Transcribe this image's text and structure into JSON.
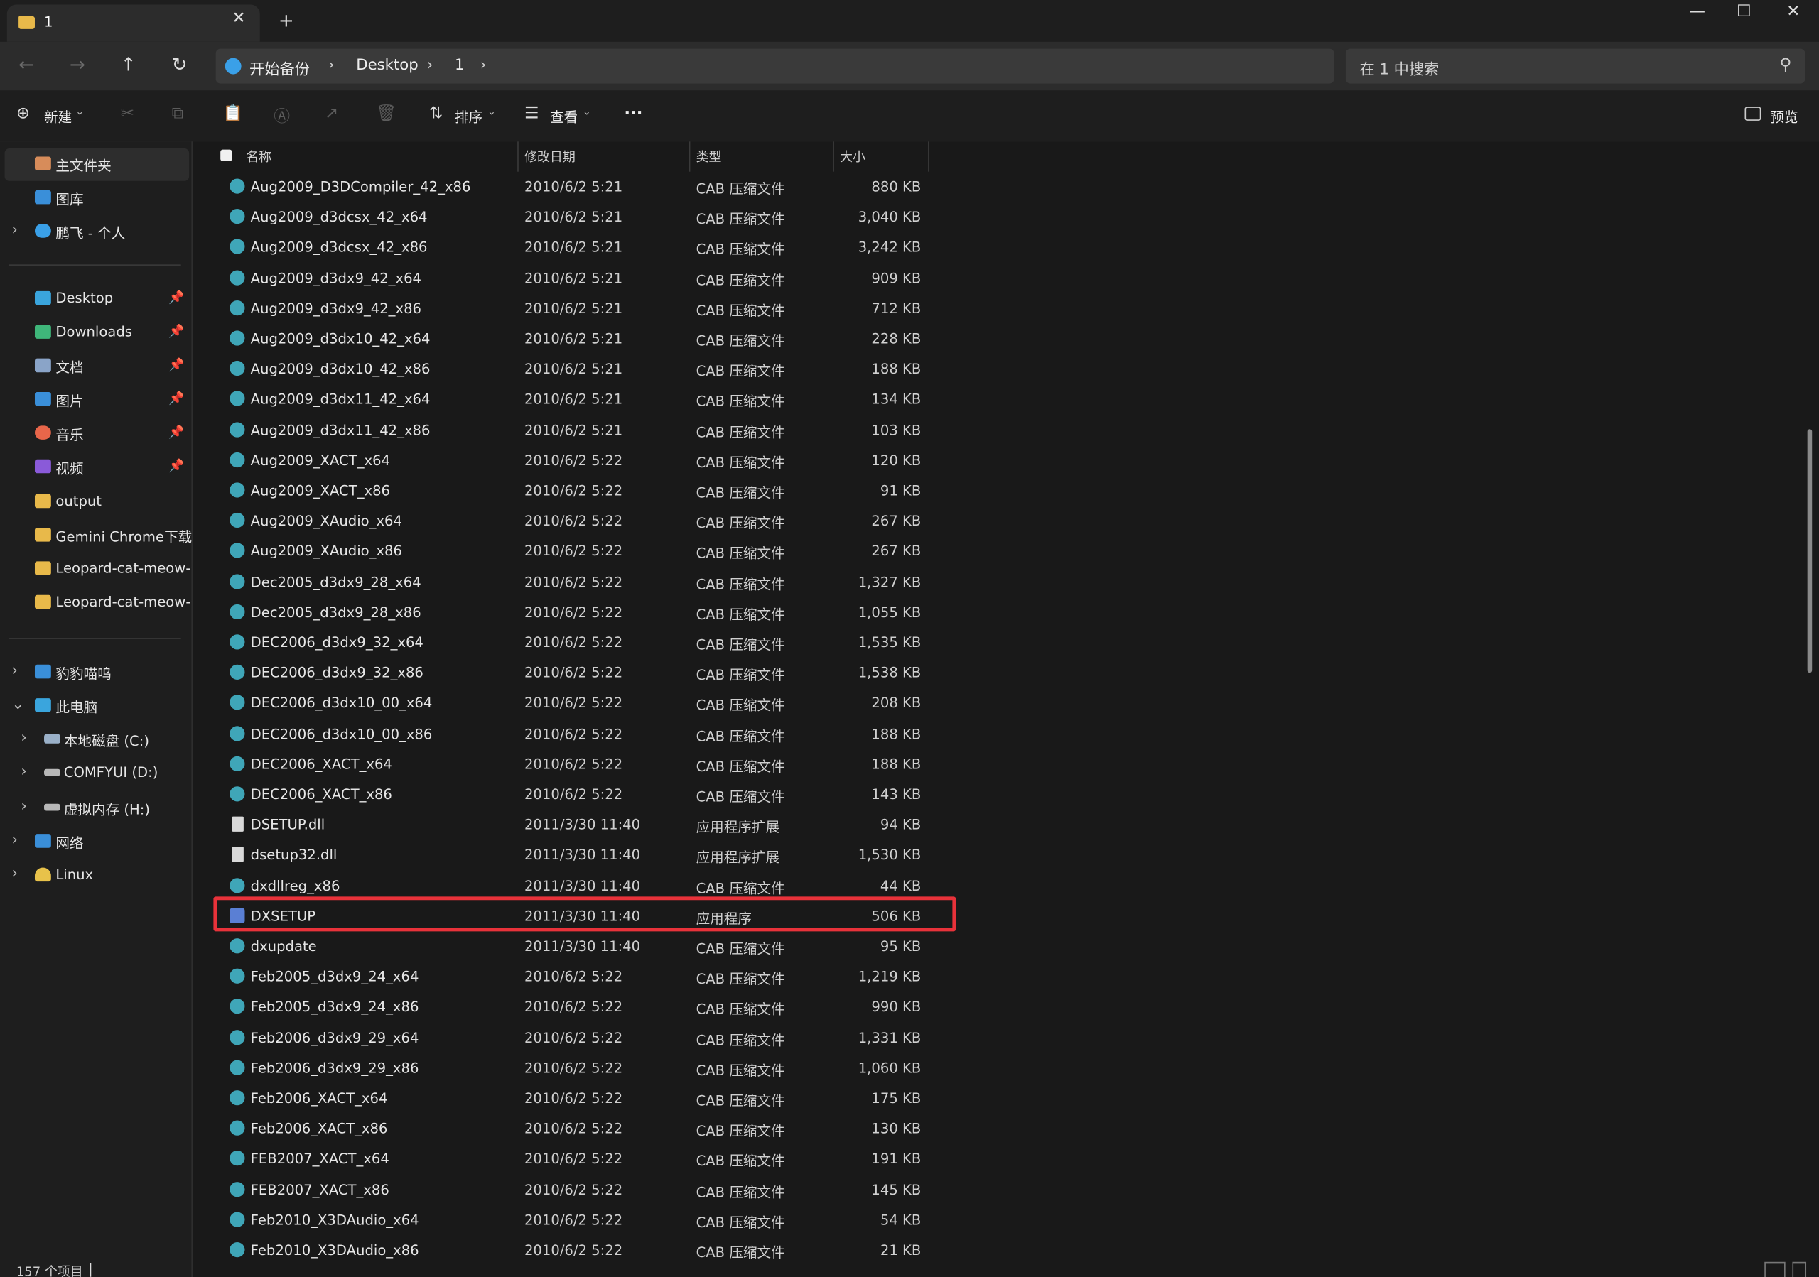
{
  "window": {
    "tab_title": "1",
    "tab_close": "✕",
    "new_tab": "+",
    "controls": [
      "—",
      "☐",
      "✕"
    ]
  },
  "address": {
    "nav": [
      "←",
      "→",
      "↑",
      "↻"
    ],
    "crumbs": [
      "开始备份",
      "Desktop",
      "1"
    ],
    "separator": "›",
    "search_placeholder": "在 1 中搜索",
    "search_icon": "⚲"
  },
  "toolbar": {
    "new": "新建",
    "disabled_icons": [
      "✂",
      "⧉",
      "📋",
      "Ⓐ",
      "↗",
      "🗑"
    ],
    "sort": "排序",
    "view": "查看",
    "more": "···",
    "preview": "预览"
  },
  "sidebar": {
    "top_items": [
      {
        "label": "主文件夹",
        "icon": "home-icon",
        "color": "#d78c5a",
        "selected": true
      },
      {
        "label": "图库",
        "icon": "gallery-icon",
        "color": "#3a8fd9"
      },
      {
        "label": "鹏飞 - 个人",
        "icon": "cloud-icon",
        "color": "#3aa0e8",
        "expand": true
      }
    ],
    "pinned": [
      {
        "label": "Desktop",
        "icon": "desktop-icon",
        "color": "#3aa5dd",
        "pinned": true
      },
      {
        "label": "Downloads",
        "icon": "download-icon",
        "color": "#3fb67a",
        "pinned": true
      },
      {
        "label": "文档",
        "icon": "document-icon",
        "color": "#8aa4c8",
        "pinned": true
      },
      {
        "label": "图片",
        "icon": "pictures-icon",
        "color": "#3a8fd9",
        "pinned": true
      },
      {
        "label": "音乐",
        "icon": "music-icon",
        "color": "#e8664a",
        "pinned": true
      },
      {
        "label": "视频",
        "icon": "video-icon",
        "color": "#8a5ad9",
        "pinned": true
      },
      {
        "label": "output",
        "icon": "folder-icon",
        "color": "#e8b94a"
      },
      {
        "label": "Gemini Chrome下载",
        "icon": "folder-icon",
        "color": "#e8b94a"
      },
      {
        "label": "Leopard-cat-meow-Co",
        "icon": "folder-icon",
        "color": "#e8b94a"
      },
      {
        "label": "Leopard-cat-meow-Co",
        "icon": "folder-icon",
        "color": "#e8b94a"
      }
    ],
    "tree": [
      {
        "label": "豹豹喵呜",
        "icon": "cloud-folder-icon",
        "color": "#3a8fd9",
        "chev": "›",
        "indent": 0
      },
      {
        "label": "此电脑",
        "icon": "pc-icon",
        "color": "#3aa5dd",
        "chev": "⌄",
        "indent": 0
      },
      {
        "label": "本地磁盘 (C:)",
        "icon": "drive-icon",
        "color": "#9ab0c8",
        "chev": "›",
        "indent": 1
      },
      {
        "label": "COMFYUI (D:)",
        "icon": "drive-icon",
        "color": "#b8b8b8",
        "chev": "›",
        "indent": 1
      },
      {
        "label": "虚拟内存 (H:)",
        "icon": "drive-icon",
        "color": "#b8b8b8",
        "chev": "›",
        "indent": 1
      },
      {
        "label": "网络",
        "icon": "network-icon",
        "color": "#3a8fd9",
        "chev": "›",
        "indent": 0
      },
      {
        "label": "Linux",
        "icon": "linux-icon",
        "color": "#e8c24a",
        "chev": "›",
        "indent": 0
      }
    ]
  },
  "columns": {
    "name": "名称",
    "date": "修改日期",
    "type": "类型",
    "size": "大小"
  },
  "files": [
    {
      "name": "Aug2009_D3DCompiler_42_x86",
      "date": "2010/6/2 5:21",
      "type": "CAB 压缩文件",
      "size": "880 KB",
      "icon": "cab"
    },
    {
      "name": "Aug2009_d3dcsx_42_x64",
      "date": "2010/6/2 5:21",
      "type": "CAB 压缩文件",
      "size": "3,040 KB",
      "icon": "cab"
    },
    {
      "name": "Aug2009_d3dcsx_42_x86",
      "date": "2010/6/2 5:21",
      "type": "CAB 压缩文件",
      "size": "3,242 KB",
      "icon": "cab"
    },
    {
      "name": "Aug2009_d3dx9_42_x64",
      "date": "2010/6/2 5:21",
      "type": "CAB 压缩文件",
      "size": "909 KB",
      "icon": "cab"
    },
    {
      "name": "Aug2009_d3dx9_42_x86",
      "date": "2010/6/2 5:21",
      "type": "CAB 压缩文件",
      "size": "712 KB",
      "icon": "cab"
    },
    {
      "name": "Aug2009_d3dx10_42_x64",
      "date": "2010/6/2 5:21",
      "type": "CAB 压缩文件",
      "size": "228 KB",
      "icon": "cab"
    },
    {
      "name": "Aug2009_d3dx10_42_x86",
      "date": "2010/6/2 5:21",
      "type": "CAB 压缩文件",
      "size": "188 KB",
      "icon": "cab"
    },
    {
      "name": "Aug2009_d3dx11_42_x64",
      "date": "2010/6/2 5:21",
      "type": "CAB 压缩文件",
      "size": "134 KB",
      "icon": "cab"
    },
    {
      "name": "Aug2009_d3dx11_42_x86",
      "date": "2010/6/2 5:21",
      "type": "CAB 压缩文件",
      "size": "103 KB",
      "icon": "cab"
    },
    {
      "name": "Aug2009_XACT_x64",
      "date": "2010/6/2 5:22",
      "type": "CAB 压缩文件",
      "size": "120 KB",
      "icon": "cab"
    },
    {
      "name": "Aug2009_XACT_x86",
      "date": "2010/6/2 5:22",
      "type": "CAB 压缩文件",
      "size": "91 KB",
      "icon": "cab"
    },
    {
      "name": "Aug2009_XAudio_x64",
      "date": "2010/6/2 5:22",
      "type": "CAB 压缩文件",
      "size": "267 KB",
      "icon": "cab"
    },
    {
      "name": "Aug2009_XAudio_x86",
      "date": "2010/6/2 5:22",
      "type": "CAB 压缩文件",
      "size": "267 KB",
      "icon": "cab"
    },
    {
      "name": "Dec2005_d3dx9_28_x64",
      "date": "2010/6/2 5:22",
      "type": "CAB 压缩文件",
      "size": "1,327 KB",
      "icon": "cab"
    },
    {
      "name": "Dec2005_d3dx9_28_x86",
      "date": "2010/6/2 5:22",
      "type": "CAB 压缩文件",
      "size": "1,055 KB",
      "icon": "cab"
    },
    {
      "name": "DEC2006_d3dx9_32_x64",
      "date": "2010/6/2 5:22",
      "type": "CAB 压缩文件",
      "size": "1,535 KB",
      "icon": "cab"
    },
    {
      "name": "DEC2006_d3dx9_32_x86",
      "date": "2010/6/2 5:22",
      "type": "CAB 压缩文件",
      "size": "1,538 KB",
      "icon": "cab"
    },
    {
      "name": "DEC2006_d3dx10_00_x64",
      "date": "2010/6/2 5:22",
      "type": "CAB 压缩文件",
      "size": "208 KB",
      "icon": "cab"
    },
    {
      "name": "DEC2006_d3dx10_00_x86",
      "date": "2010/6/2 5:22",
      "type": "CAB 压缩文件",
      "size": "188 KB",
      "icon": "cab"
    },
    {
      "name": "DEC2006_XACT_x64",
      "date": "2010/6/2 5:22",
      "type": "CAB 压缩文件",
      "size": "188 KB",
      "icon": "cab"
    },
    {
      "name": "DEC2006_XACT_x86",
      "date": "2010/6/2 5:22",
      "type": "CAB 压缩文件",
      "size": "143 KB",
      "icon": "cab"
    },
    {
      "name": "DSETUP.dll",
      "date": "2011/3/30 11:40",
      "type": "应用程序扩展",
      "size": "94 KB",
      "icon": "dll"
    },
    {
      "name": "dsetup32.dll",
      "date": "2011/3/30 11:40",
      "type": "应用程序扩展",
      "size": "1,530 KB",
      "icon": "dll"
    },
    {
      "name": "dxdllreg_x86",
      "date": "2011/3/30 11:40",
      "type": "CAB 压缩文件",
      "size": "44 KB",
      "icon": "cab"
    },
    {
      "name": "DXSETUP",
      "date": "2011/3/30 11:40",
      "type": "应用程序",
      "size": "506 KB",
      "icon": "exe",
      "highlighted": true
    },
    {
      "name": "dxupdate",
      "date": "2011/3/30 11:40",
      "type": "CAB 压缩文件",
      "size": "95 KB",
      "icon": "cab"
    },
    {
      "name": "Feb2005_d3dx9_24_x64",
      "date": "2010/6/2 5:22",
      "type": "CAB 压缩文件",
      "size": "1,219 KB",
      "icon": "cab"
    },
    {
      "name": "Feb2005_d3dx9_24_x86",
      "date": "2010/6/2 5:22",
      "type": "CAB 压缩文件",
      "size": "990 KB",
      "icon": "cab"
    },
    {
      "name": "Feb2006_d3dx9_29_x64",
      "date": "2010/6/2 5:22",
      "type": "CAB 压缩文件",
      "size": "1,331 KB",
      "icon": "cab"
    },
    {
      "name": "Feb2006_d3dx9_29_x86",
      "date": "2010/6/2 5:22",
      "type": "CAB 压缩文件",
      "size": "1,060 KB",
      "icon": "cab"
    },
    {
      "name": "Feb2006_XACT_x64",
      "date": "2010/6/2 5:22",
      "type": "CAB 压缩文件",
      "size": "175 KB",
      "icon": "cab"
    },
    {
      "name": "Feb2006_XACT_x86",
      "date": "2010/6/2 5:22",
      "type": "CAB 压缩文件",
      "size": "130 KB",
      "icon": "cab"
    },
    {
      "name": "FEB2007_XACT_x64",
      "date": "2010/6/2 5:22",
      "type": "CAB 压缩文件",
      "size": "191 KB",
      "icon": "cab"
    },
    {
      "name": "FEB2007_XACT_x86",
      "date": "2010/6/2 5:22",
      "type": "CAB 压缩文件",
      "size": "145 KB",
      "icon": "cab"
    },
    {
      "name": "Feb2010_X3DAudio_x64",
      "date": "2010/6/2 5:22",
      "type": "CAB 压缩文件",
      "size": "54 KB",
      "icon": "cab"
    },
    {
      "name": "Feb2010_X3DAudio_x86",
      "date": "2010/6/2 5:22",
      "type": "CAB 压缩文件",
      "size": "21 KB",
      "icon": "cab"
    }
  ],
  "status": {
    "item_count": "157 个项目",
    "cursor": "|"
  },
  "colors": {
    "highlight": "#e8323a",
    "cab_icon": "#3fa6b8"
  }
}
